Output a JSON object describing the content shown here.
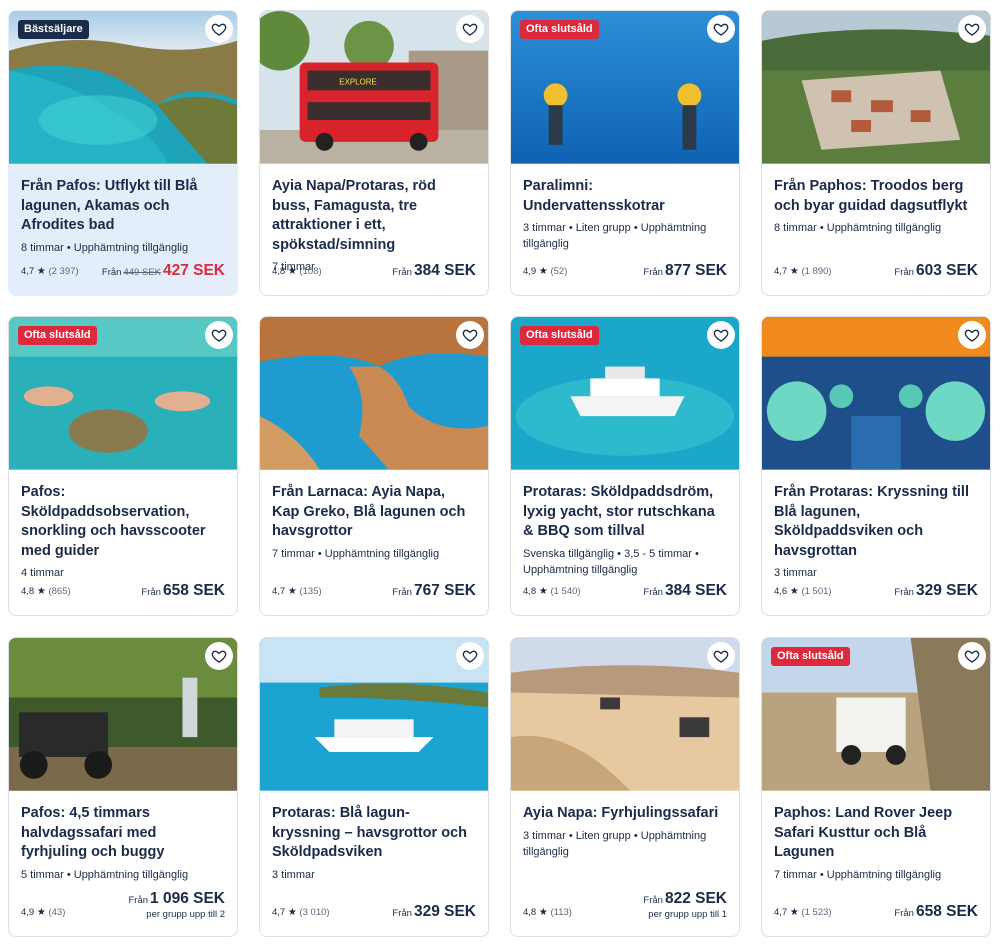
{
  "colors": {
    "text": "#1a2b49",
    "sale": "#dc2a3c",
    "badge_dark": "#1a2b49",
    "badge_red": "#dc2a3c",
    "highlight_bg": "#e4eefb"
  },
  "cards": [
    {
      "badge": "Bästsäljare",
      "title": "Från Pafos: Utflykt till Blå lagunen, Akamas och Afrodites bad",
      "meta": "8 timmar • Upphämtning tillgänglig",
      "rating": "4,7",
      "reviews": "(2 397)",
      "from": "Från",
      "old_price": "449 SEK",
      "price": "427 SEK",
      "sub": ""
    },
    {
      "badge": "",
      "title": "Ayia Napa/Protaras, röd buss, Famagusta, tre attraktioner i ett, spökstad/simning",
      "meta": "7 timmar",
      "rating": "4,8",
      "reviews": "(108)",
      "from": "Från",
      "old_price": "",
      "price": "384 SEK",
      "sub": ""
    },
    {
      "badge": "Ofta slutsåld",
      "title": "Paralimni: Undervattensskotrar",
      "meta": "3 timmar • Liten grupp • Upphämtning tillgänglig",
      "rating": "4,9",
      "reviews": "(52)",
      "from": "Från",
      "old_price": "",
      "price": "877 SEK",
      "sub": ""
    },
    {
      "badge": "",
      "title": "Från Paphos: Troodos berg och byar guidad dagsutflykt",
      "meta": "8 timmar • Upphämtning tillgänglig",
      "rating": "4,7",
      "reviews": "(1 890)",
      "from": "Från",
      "old_price": "",
      "price": "603 SEK",
      "sub": ""
    },
    {
      "badge": "Ofta slutsåld",
      "title": "Pafos: Sköldpaddsobservation, snorkling och havsscooter med guider",
      "meta": "4 timmar",
      "rating": "4,8",
      "reviews": "(865)",
      "from": "Från",
      "old_price": "",
      "price": "658 SEK",
      "sub": ""
    },
    {
      "badge": "",
      "title": "Från Larnaca: Ayia Napa, Kap Greko, Blå lagunen och havsgrottor",
      "meta": "7 timmar • Upphämtning tillgänglig",
      "rating": "4,7",
      "reviews": "(135)",
      "from": "Från",
      "old_price": "",
      "price": "767 SEK",
      "sub": ""
    },
    {
      "badge": "Ofta slutsåld",
      "title": "Protaras: Sköldpaddsdröm, lyxig yacht, stor rutschkana & BBQ som tillval",
      "meta": "Svenska tillgänglig • 3,5 - 5 timmar • Upphämtning tillgänglig",
      "rating": "4,8",
      "reviews": "(1 540)",
      "from": "Från",
      "old_price": "",
      "price": "384 SEK",
      "sub": ""
    },
    {
      "badge": "",
      "title": "Från Protaras: Kryssning till Blå lagunen, Sköldpaddsviken och havsgrottan",
      "meta": "3 timmar",
      "rating": "4,6",
      "reviews": "(1 501)",
      "from": "Från",
      "old_price": "",
      "price": "329 SEK",
      "sub": ""
    },
    {
      "badge": "",
      "title": "Pafos: 4,5 timmars halvdagssafari med fyrhjuling och buggy",
      "meta": "5 timmar • Upphämtning tillgänglig",
      "rating": "4,9",
      "reviews": "(43)",
      "from": "Från",
      "old_price": "",
      "price": "1 096 SEK",
      "sub": "per grupp upp till 2"
    },
    {
      "badge": "",
      "title": "Protaras: Blå lagun-kryssning – havsgrottor och Sköldpadsviken",
      "meta": "3 timmar",
      "rating": "4,7",
      "reviews": "(3 010)",
      "from": "Från",
      "old_price": "",
      "price": "329 SEK",
      "sub": ""
    },
    {
      "badge": "",
      "title": "Ayia Napa: Fyrhjulingssafari",
      "meta": "3 timmar • Liten grupp • Upphämtning tillgänglig",
      "rating": "4,8",
      "reviews": "(113)",
      "from": "Från",
      "old_price": "",
      "price": "822 SEK",
      "sub": "per grupp upp till 1"
    },
    {
      "badge": "Ofta slutsåld",
      "title": "Paphos: Land Rover Jeep Safari Kusttur och Blå Lagunen",
      "meta": "7 timmar • Upphämtning tillgänglig",
      "rating": "4,7",
      "reviews": "(1 523)",
      "from": "Från",
      "old_price": "",
      "price": "658 SEK",
      "sub": ""
    }
  ]
}
